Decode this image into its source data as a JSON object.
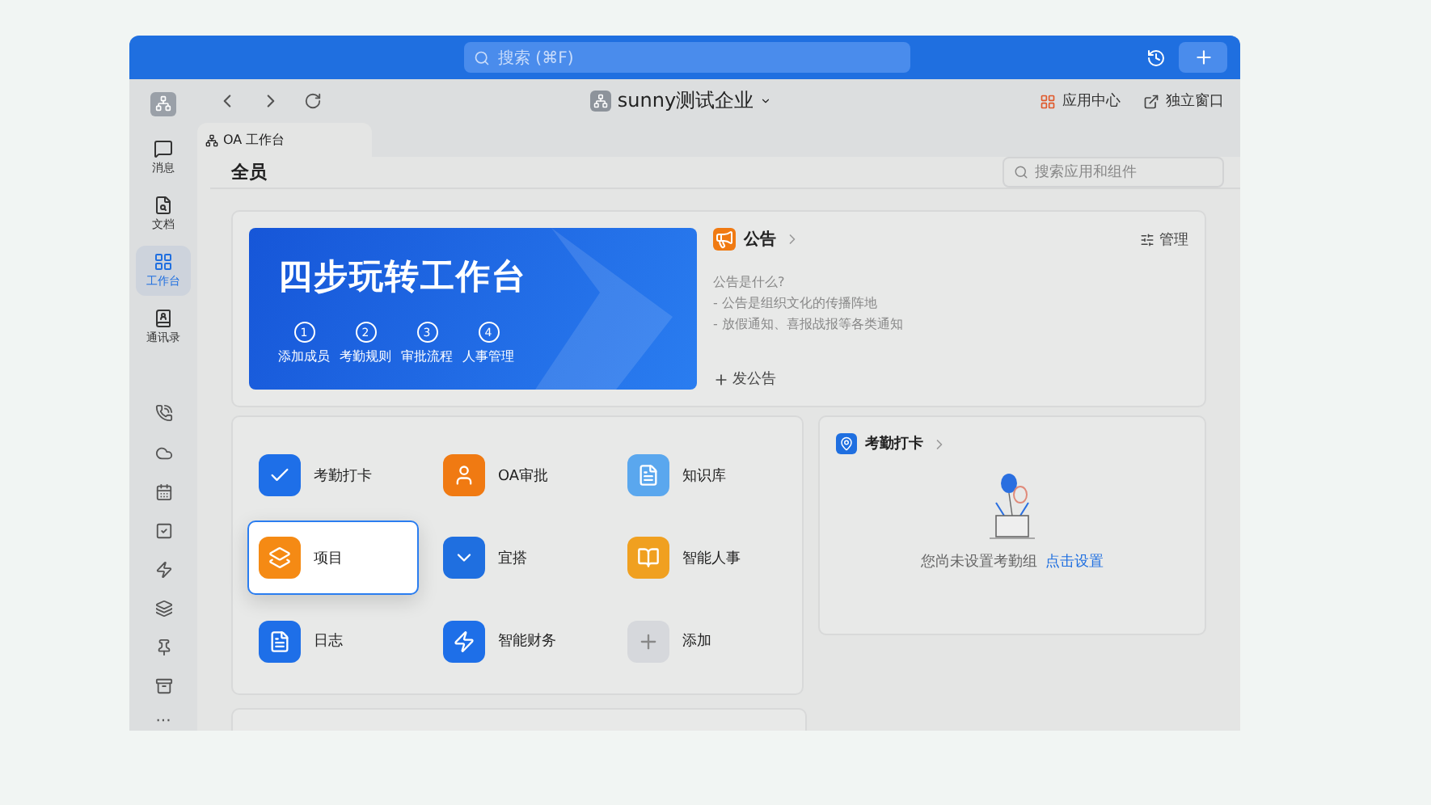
{
  "title_bar": {
    "search_placeholder": "搜索 (⌘F)"
  },
  "nav_bar": {
    "company": "sunny测试企业",
    "actions": [
      {
        "label": "应用中心",
        "kind": "apps"
      },
      {
        "label": "独立窗口",
        "kind": "window"
      }
    ]
  },
  "sidebar": {
    "items": [
      {
        "label": "消息",
        "kind": "message",
        "selected": false
      },
      {
        "label": "文档",
        "kind": "doc",
        "selected": false
      },
      {
        "label": "工作台",
        "kind": "grid",
        "selected": true
      },
      {
        "label": "通讯录",
        "kind": "contacts",
        "selected": false
      }
    ],
    "tools": [
      {
        "kind": "phone"
      },
      {
        "kind": "cloud"
      },
      {
        "kind": "calendar"
      },
      {
        "kind": "todo"
      },
      {
        "kind": "bolt"
      },
      {
        "kind": "layers"
      },
      {
        "kind": "pin"
      },
      {
        "kind": "box"
      }
    ],
    "more": "···"
  },
  "tabs": [
    {
      "label": "OA 工作台",
      "selected": true
    }
  ],
  "header": {
    "title": "全员",
    "search_placeholder": "搜索应用和组件"
  },
  "banner": {
    "title": "四步玩转工作台",
    "steps": [
      {
        "number": "1",
        "label": "添加成员"
      },
      {
        "number": "2",
        "label": "考勤规则"
      },
      {
        "number": "3",
        "label": "审批流程"
      },
      {
        "number": "4",
        "label": "人事管理"
      }
    ]
  },
  "notice": {
    "title": "公告",
    "manage": "管理",
    "lines": [
      "公告是什么?",
      "- 公告是组织文化的传播阵地",
      "- 放假通知、喜报战报等各类通知"
    ],
    "action": "发公告"
  },
  "apps": [
    {
      "label": "考勤打卡",
      "kind": "check",
      "color": "#1e6fe8",
      "selected": false
    },
    {
      "label": "OA审批",
      "kind": "stamp",
      "color": "#f07a12",
      "selected": false
    },
    {
      "label": "知识库",
      "kind": "book",
      "color": "#5aa7ee",
      "selected": false
    },
    {
      "label": "项目",
      "kind": "layers",
      "color": "#f58a14",
      "selected": true
    },
    {
      "label": "宜搭",
      "kind": "y",
      "color": "#1f6fe0",
      "selected": false
    },
    {
      "label": "智能人事",
      "kind": "h",
      "color": "#f0a020",
      "selected": false
    },
    {
      "label": "日志",
      "kind": "log",
      "color": "#1e6fe8",
      "selected": false
    },
    {
      "label": "智能财务",
      "kind": "finance",
      "color": "#1e6fe8",
      "selected": false
    },
    {
      "label": "添加",
      "kind": "add",
      "color": "#d6d8dc",
      "selected": false
    }
  ],
  "attendance": {
    "title": "考勤打卡",
    "message": "您尚未设置考勤组",
    "link": "点击设置"
  }
}
